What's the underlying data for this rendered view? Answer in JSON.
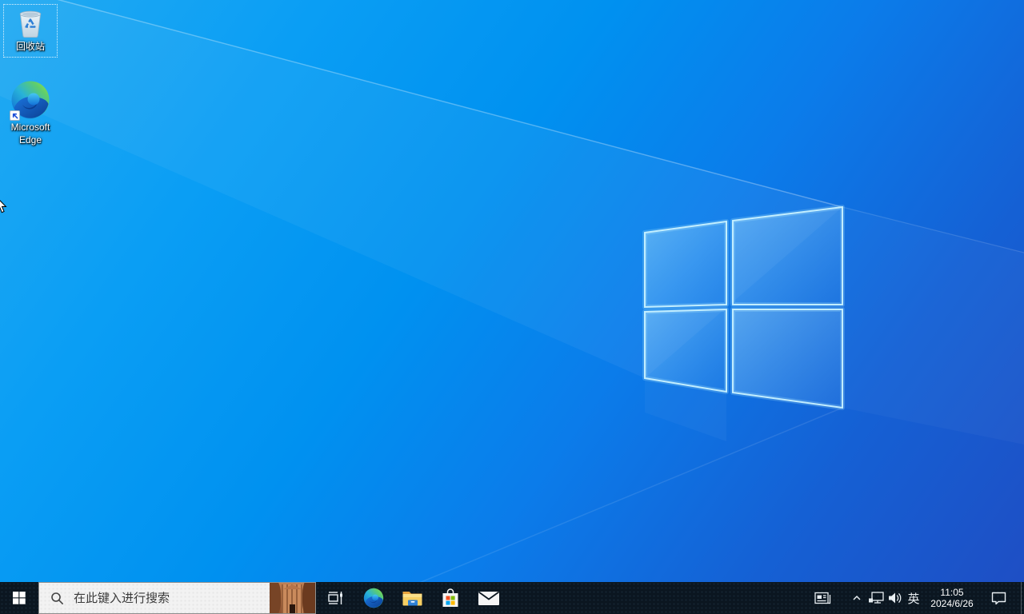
{
  "desktop": {
    "icons": [
      {
        "name": "recycle-bin",
        "label": "回收站",
        "selected": true
      },
      {
        "name": "microsoft-edge",
        "label_line1": "Microsoft",
        "label_line2": "Edge"
      }
    ]
  },
  "taskbar": {
    "search": {
      "placeholder": "在此键入进行搜索",
      "left_icon": "search-icon",
      "right_image": "petra-landmark-search-highlight"
    },
    "app_buttons": [
      {
        "icon": "start-windows-icon"
      },
      {
        "icon": "task-view-icon"
      },
      {
        "icon": "edge-browser-icon"
      },
      {
        "icon": "file-explorer-icon"
      },
      {
        "icon": "microsoft-store-icon"
      },
      {
        "icon": "mail-icon"
      }
    ],
    "tray": {
      "icons": [
        "news-icon",
        "chevron-up-icon",
        "network-icon",
        "volume-icon"
      ],
      "language": "英",
      "clock": {
        "time": "11:05",
        "date": "2024/6/26"
      },
      "action_center": "action-center-icon",
      "show_desktop": "show-desktop-strip"
    }
  },
  "colors": {
    "wallpaper_top_left": "#22aaf2",
    "wallpaper_bottom_right": "#1f4dc3",
    "logo_edge": "#c9f2ff",
    "taskbar": "#0b1620",
    "search_background": "#f2f2f2",
    "store_squares": [
      "#f25022",
      "#7fba00",
      "#00a4ef",
      "#ffb900"
    ]
  }
}
